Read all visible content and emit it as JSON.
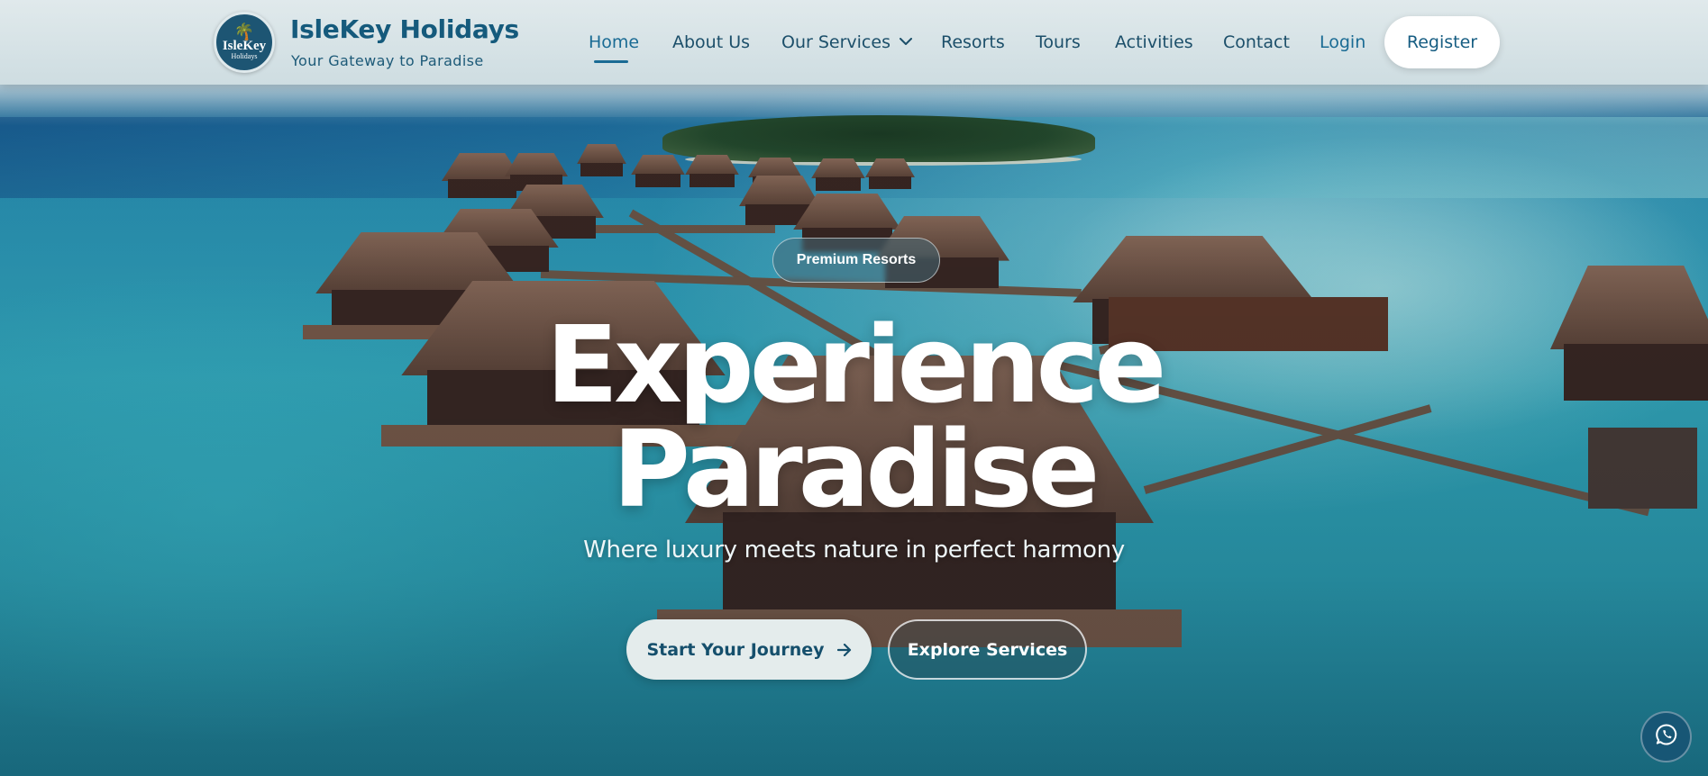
{
  "brand": {
    "logo_line1": "IsleKey",
    "logo_line2": "Holidays",
    "name": "IsleKey Holidays",
    "tagline": "Your Gateway to Paradise"
  },
  "nav": {
    "items": [
      {
        "label": "Home",
        "active": true
      },
      {
        "label": "About Us"
      },
      {
        "label": "Our Services",
        "has_dropdown": true
      },
      {
        "label": "Resorts"
      },
      {
        "label": "Tours"
      },
      {
        "label": "Activities"
      },
      {
        "label": "Contact"
      },
      {
        "label": "Login"
      }
    ],
    "register_label": "Register"
  },
  "hero": {
    "badge": "Premium Resorts",
    "title_line1": "Experience",
    "title_line2": "Paradise",
    "subtitle": "Where luxury meets nature in perfect harmony",
    "primary_button": "Start Your Journey",
    "secondary_button": "Explore Services"
  },
  "icons": {
    "logo": "palm-tree-icon",
    "dropdown": "chevron-down-icon",
    "primary_arrow": "arrow-right-icon",
    "chat": "whatsapp-icon"
  },
  "colors": {
    "brand_primary": "#155a7c",
    "nav_text": "#1c4f6a",
    "register_bg": "#ffffff",
    "chat_bg": "#175675"
  }
}
